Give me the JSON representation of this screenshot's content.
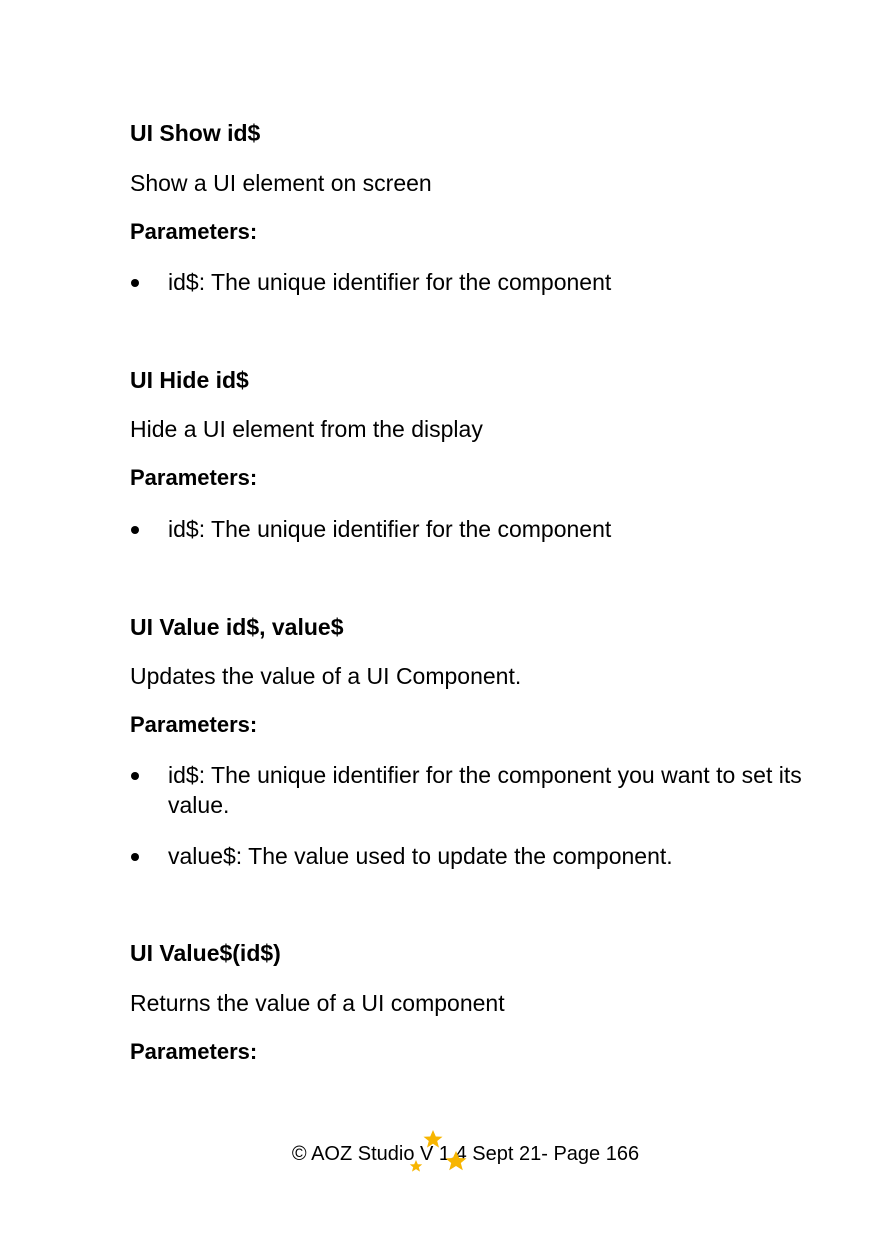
{
  "sections": [
    {
      "heading": "UI Show id$",
      "description": "Show a UI element on screen",
      "params_label": "Parameters:",
      "params": [
        "id$: The unique identifier for the component"
      ]
    },
    {
      "heading": "UI Hide id$",
      "description": "Hide a UI element from the display",
      "params_label": "Parameters:",
      "params": [
        "id$: The unique identifier for the component"
      ]
    },
    {
      "heading": "UI Value id$, value$",
      "description": "Updates the value of a UI Component.",
      "params_label": "Parameters:",
      "params": [
        "id$: The unique identifier for the component you want to set its value.",
        "value$: The value used to update the component."
      ]
    },
    {
      "heading": "UI Value$(id$)",
      "description": "Returns the value of a UI component",
      "params_label": "Parameters:",
      "params": []
    }
  ],
  "footer": {
    "text": "© AOZ Studio V 1.4 Sept 21- Page 166",
    "star_color": "#F7B500"
  }
}
